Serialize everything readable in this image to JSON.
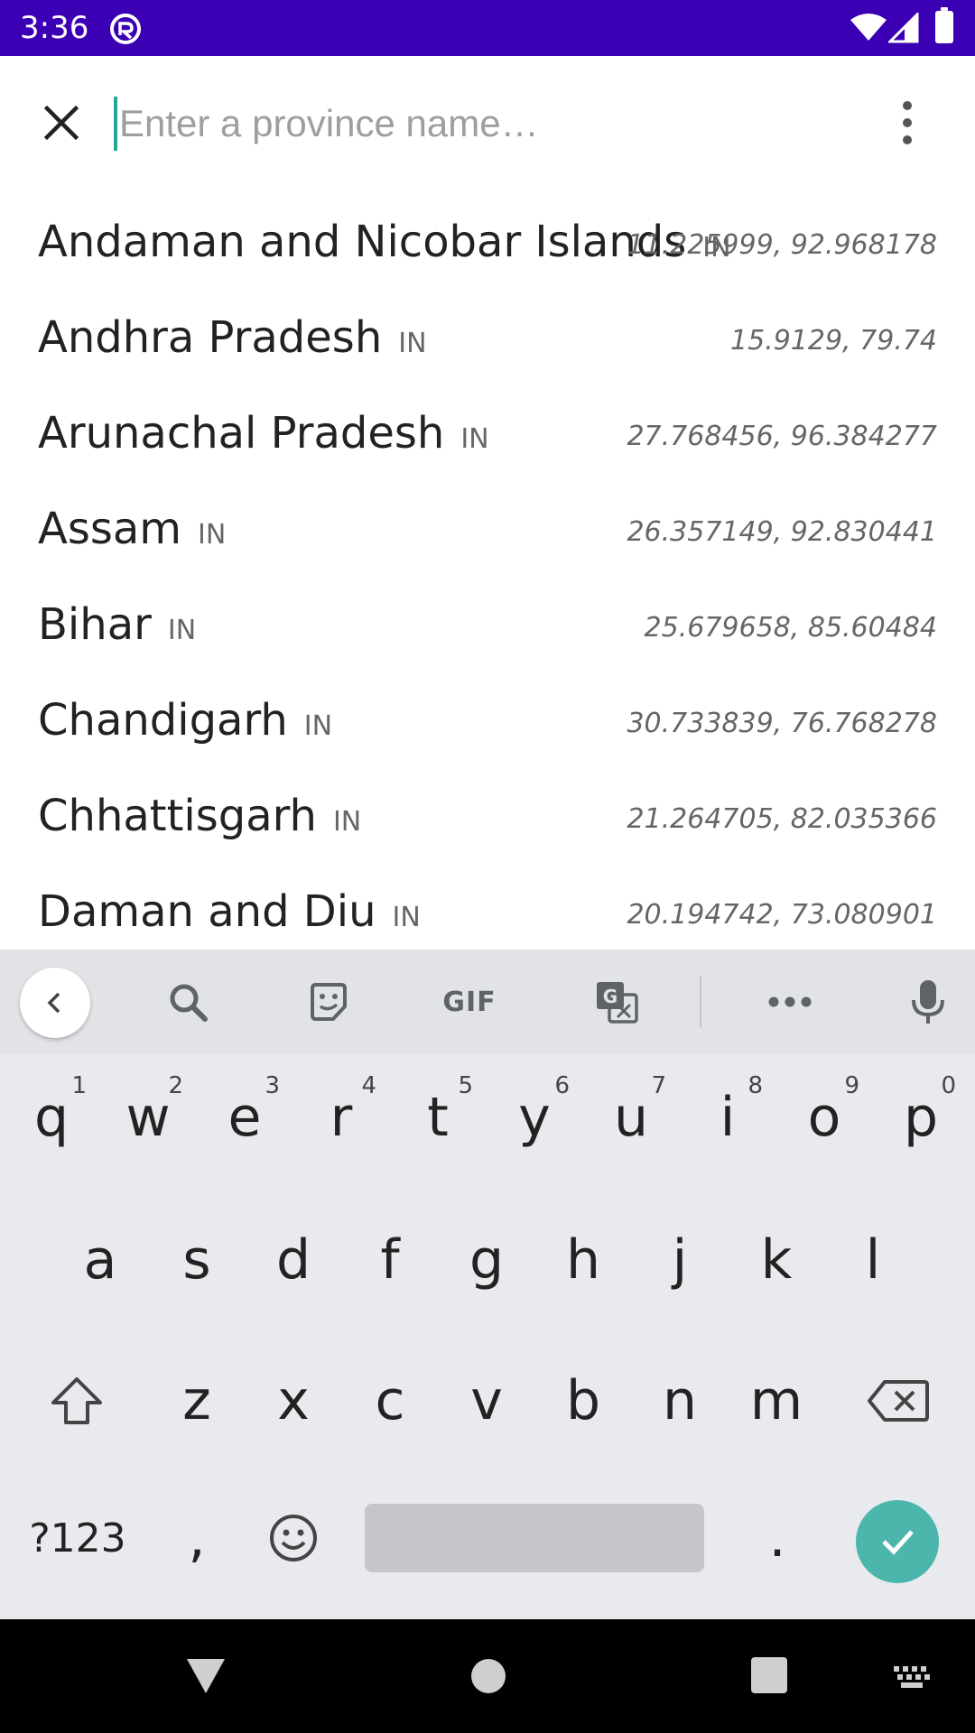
{
  "status_bar": {
    "time": "3:36"
  },
  "search": {
    "placeholder": "Enter a province name…",
    "value": ""
  },
  "provinces": [
    {
      "name": "Andaman and Nicobar Islands",
      "code": "IN",
      "coords": "11.225999, 92.968178"
    },
    {
      "name": "Andhra Pradesh",
      "code": "IN",
      "coords": "15.9129, 79.74"
    },
    {
      "name": "Arunachal Pradesh",
      "code": "IN",
      "coords": "27.768456, 96.384277"
    },
    {
      "name": "Assam",
      "code": "IN",
      "coords": "26.357149, 92.830441"
    },
    {
      "name": "Bihar",
      "code": "IN",
      "coords": "25.679658, 85.60484"
    },
    {
      "name": "Chandigarh",
      "code": "IN",
      "coords": "30.733839, 76.768278"
    },
    {
      "name": "Chhattisgarh",
      "code": "IN",
      "coords": "21.264705, 82.035366"
    },
    {
      "name": "Daman and Diu",
      "code": "IN",
      "coords": "20.194742, 73.080901"
    }
  ],
  "keyboard": {
    "toolbar": {
      "gif_label": "GIF"
    },
    "row1": [
      {
        "k": "q",
        "h": "1"
      },
      {
        "k": "w",
        "h": "2"
      },
      {
        "k": "e",
        "h": "3"
      },
      {
        "k": "r",
        "h": "4"
      },
      {
        "k": "t",
        "h": "5"
      },
      {
        "k": "y",
        "h": "6"
      },
      {
        "k": "u",
        "h": "7"
      },
      {
        "k": "i",
        "h": "8"
      },
      {
        "k": "o",
        "h": "9"
      },
      {
        "k": "p",
        "h": "0"
      }
    ],
    "row2": [
      "a",
      "s",
      "d",
      "f",
      "g",
      "h",
      "j",
      "k",
      "l"
    ],
    "row3": [
      "z",
      "x",
      "c",
      "v",
      "b",
      "n",
      "m"
    ],
    "symbols_label": "?123",
    "comma": ",",
    "period": "."
  },
  "colors": {
    "status_bar": "#3c00b4",
    "accent": "#26a69a",
    "enter_key": "#4db6ac"
  },
  "icons": [
    "close-icon",
    "overflow-menu-icon",
    "chevron-left-icon",
    "search-icon",
    "sticker-icon",
    "translate-icon",
    "more-icon",
    "mic-icon",
    "shift-icon",
    "backspace-icon",
    "emoji-icon",
    "check-icon"
  ]
}
